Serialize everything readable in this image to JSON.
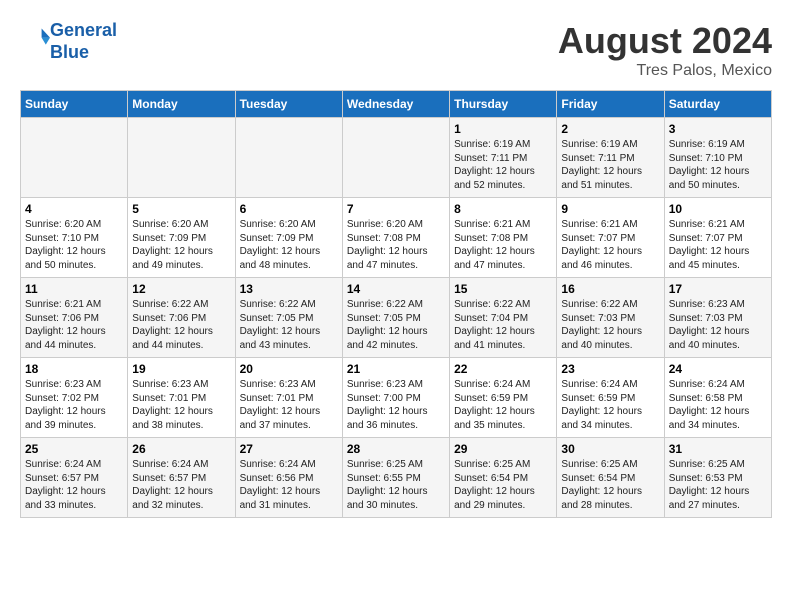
{
  "header": {
    "logo_line1": "General",
    "logo_line2": "Blue",
    "title": "August 2024",
    "subtitle": "Tres Palos, Mexico"
  },
  "weekdays": [
    "Sunday",
    "Monday",
    "Tuesday",
    "Wednesday",
    "Thursday",
    "Friday",
    "Saturday"
  ],
  "weeks": [
    [
      {
        "day": "",
        "info": ""
      },
      {
        "day": "",
        "info": ""
      },
      {
        "day": "",
        "info": ""
      },
      {
        "day": "",
        "info": ""
      },
      {
        "day": "1",
        "info": "Sunrise: 6:19 AM\nSunset: 7:11 PM\nDaylight: 12 hours and 52 minutes."
      },
      {
        "day": "2",
        "info": "Sunrise: 6:19 AM\nSunset: 7:11 PM\nDaylight: 12 hours and 51 minutes."
      },
      {
        "day": "3",
        "info": "Sunrise: 6:19 AM\nSunset: 7:10 PM\nDaylight: 12 hours and 50 minutes."
      }
    ],
    [
      {
        "day": "4",
        "info": "Sunrise: 6:20 AM\nSunset: 7:10 PM\nDaylight: 12 hours and 50 minutes."
      },
      {
        "day": "5",
        "info": "Sunrise: 6:20 AM\nSunset: 7:09 PM\nDaylight: 12 hours and 49 minutes."
      },
      {
        "day": "6",
        "info": "Sunrise: 6:20 AM\nSunset: 7:09 PM\nDaylight: 12 hours and 48 minutes."
      },
      {
        "day": "7",
        "info": "Sunrise: 6:20 AM\nSunset: 7:08 PM\nDaylight: 12 hours and 47 minutes."
      },
      {
        "day": "8",
        "info": "Sunrise: 6:21 AM\nSunset: 7:08 PM\nDaylight: 12 hours and 47 minutes."
      },
      {
        "day": "9",
        "info": "Sunrise: 6:21 AM\nSunset: 7:07 PM\nDaylight: 12 hours and 46 minutes."
      },
      {
        "day": "10",
        "info": "Sunrise: 6:21 AM\nSunset: 7:07 PM\nDaylight: 12 hours and 45 minutes."
      }
    ],
    [
      {
        "day": "11",
        "info": "Sunrise: 6:21 AM\nSunset: 7:06 PM\nDaylight: 12 hours and 44 minutes."
      },
      {
        "day": "12",
        "info": "Sunrise: 6:22 AM\nSunset: 7:06 PM\nDaylight: 12 hours and 44 minutes."
      },
      {
        "day": "13",
        "info": "Sunrise: 6:22 AM\nSunset: 7:05 PM\nDaylight: 12 hours and 43 minutes."
      },
      {
        "day": "14",
        "info": "Sunrise: 6:22 AM\nSunset: 7:05 PM\nDaylight: 12 hours and 42 minutes."
      },
      {
        "day": "15",
        "info": "Sunrise: 6:22 AM\nSunset: 7:04 PM\nDaylight: 12 hours and 41 minutes."
      },
      {
        "day": "16",
        "info": "Sunrise: 6:22 AM\nSunset: 7:03 PM\nDaylight: 12 hours and 40 minutes."
      },
      {
        "day": "17",
        "info": "Sunrise: 6:23 AM\nSunset: 7:03 PM\nDaylight: 12 hours and 40 minutes."
      }
    ],
    [
      {
        "day": "18",
        "info": "Sunrise: 6:23 AM\nSunset: 7:02 PM\nDaylight: 12 hours and 39 minutes."
      },
      {
        "day": "19",
        "info": "Sunrise: 6:23 AM\nSunset: 7:01 PM\nDaylight: 12 hours and 38 minutes."
      },
      {
        "day": "20",
        "info": "Sunrise: 6:23 AM\nSunset: 7:01 PM\nDaylight: 12 hours and 37 minutes."
      },
      {
        "day": "21",
        "info": "Sunrise: 6:23 AM\nSunset: 7:00 PM\nDaylight: 12 hours and 36 minutes."
      },
      {
        "day": "22",
        "info": "Sunrise: 6:24 AM\nSunset: 6:59 PM\nDaylight: 12 hours and 35 minutes."
      },
      {
        "day": "23",
        "info": "Sunrise: 6:24 AM\nSunset: 6:59 PM\nDaylight: 12 hours and 34 minutes."
      },
      {
        "day": "24",
        "info": "Sunrise: 6:24 AM\nSunset: 6:58 PM\nDaylight: 12 hours and 34 minutes."
      }
    ],
    [
      {
        "day": "25",
        "info": "Sunrise: 6:24 AM\nSunset: 6:57 PM\nDaylight: 12 hours and 33 minutes."
      },
      {
        "day": "26",
        "info": "Sunrise: 6:24 AM\nSunset: 6:57 PM\nDaylight: 12 hours and 32 minutes."
      },
      {
        "day": "27",
        "info": "Sunrise: 6:24 AM\nSunset: 6:56 PM\nDaylight: 12 hours and 31 minutes."
      },
      {
        "day": "28",
        "info": "Sunrise: 6:25 AM\nSunset: 6:55 PM\nDaylight: 12 hours and 30 minutes."
      },
      {
        "day": "29",
        "info": "Sunrise: 6:25 AM\nSunset: 6:54 PM\nDaylight: 12 hours and 29 minutes."
      },
      {
        "day": "30",
        "info": "Sunrise: 6:25 AM\nSunset: 6:54 PM\nDaylight: 12 hours and 28 minutes."
      },
      {
        "day": "31",
        "info": "Sunrise: 6:25 AM\nSunset: 6:53 PM\nDaylight: 12 hours and 27 minutes."
      }
    ]
  ]
}
